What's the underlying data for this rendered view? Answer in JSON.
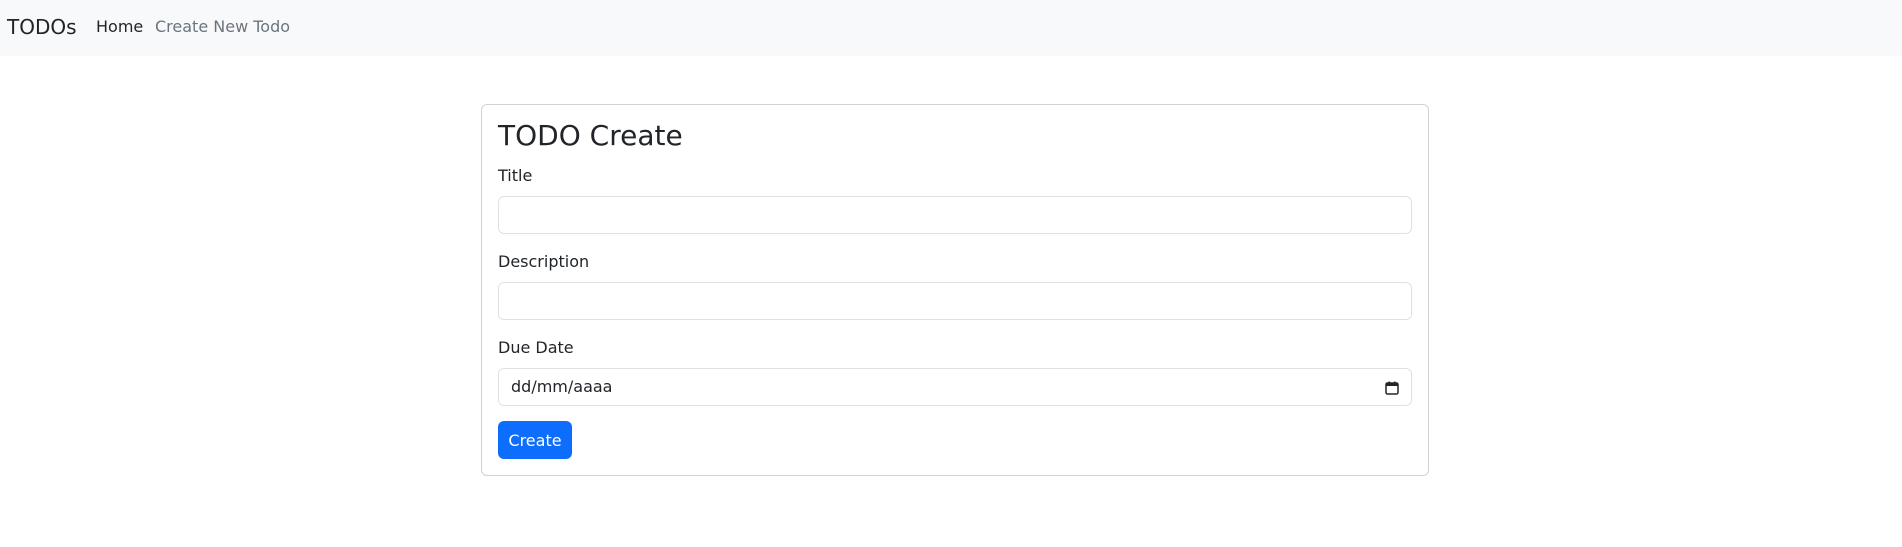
{
  "navbar": {
    "brand": "TODOs",
    "links": [
      {
        "label": "Home",
        "active": true
      },
      {
        "label": "Create New Todo",
        "active": false
      }
    ]
  },
  "form": {
    "title": "TODO Create",
    "fields": {
      "title": {
        "label": "Title",
        "value": "",
        "placeholder": ""
      },
      "description": {
        "label": "Description",
        "value": "",
        "placeholder": ""
      },
      "due_date": {
        "label": "Due Date",
        "value": "dd/mm/aaaa",
        "icon": "calendar-icon"
      }
    },
    "submit_label": "Create"
  },
  "colors": {
    "navbar_bg": "#f8f9fa",
    "primary": "#0d6efd",
    "muted_link": "#6c757d",
    "text": "#212529",
    "border": "#dee2e6"
  }
}
